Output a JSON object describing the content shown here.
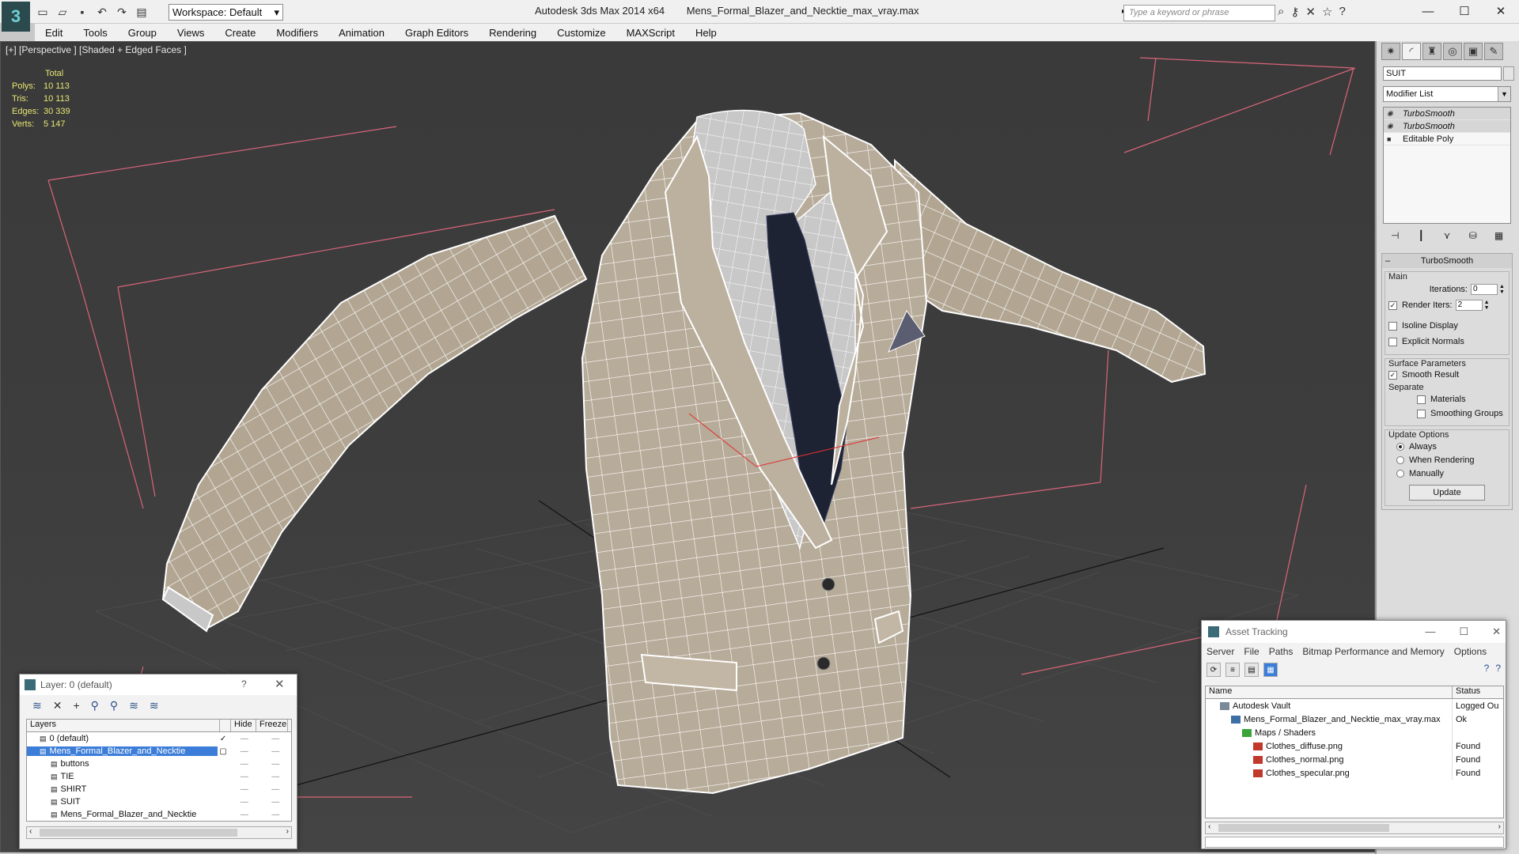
{
  "titlebar": {
    "workspace_label": "Workspace: Default",
    "app_name": "Autodesk 3ds Max  2014 x64",
    "file_name": "Mens_Formal_Blazer_and_Necktie_max_vray.max",
    "search_placeholder": "Type a keyword or phrase"
  },
  "menu": [
    "Edit",
    "Tools",
    "Group",
    "Views",
    "Create",
    "Modifiers",
    "Animation",
    "Graph Editors",
    "Rendering",
    "Customize",
    "MAXScript",
    "Help"
  ],
  "viewport": {
    "label": "[+] [Perspective ] [Shaded + Edged Faces ]",
    "stats": {
      "header": "Total",
      "rows": [
        {
          "label": "Polys:",
          "value": "10 113"
        },
        {
          "label": "Tris:",
          "value": "10 113"
        },
        {
          "label": "Edges:",
          "value": "30 339"
        },
        {
          "label": "Verts:",
          "value": "5 147"
        }
      ]
    },
    "colors": {
      "jacket": "#b9ad9b",
      "wire": "#ffffff",
      "tie": "#1e2333",
      "bbox": "#d9657a"
    }
  },
  "command_panel": {
    "object_name": "SUIT",
    "modifier_list": "Modifier List",
    "stack": [
      "TurboSmooth",
      "TurboSmooth",
      "Editable Poly"
    ],
    "rollout_title": "TurboSmooth",
    "main_label": "Main",
    "iterations_label": "Iterations:",
    "iterations_value": "0",
    "render_iters_label": "Render Iters:",
    "render_iters_value": "2",
    "isoline_label": "Isoline Display",
    "explicit_normals_label": "Explicit Normals",
    "surface_label": "Surface Parameters",
    "smooth_result_label": "Smooth Result",
    "separate_label": "Separate",
    "materials_label": "Materials",
    "smoothing_groups_label": "Smoothing Groups",
    "update_options_label": "Update Options",
    "always_label": "Always",
    "when_rendering_label": "When Rendering",
    "manually_label": "Manually",
    "update_button": "Update"
  },
  "layer_window": {
    "title": "Layer: 0 (default)",
    "help": "?",
    "col_layers": "Layers",
    "col_hide": "Hide",
    "col_freeze": "Freeze",
    "rows": [
      {
        "name": "0 (default)",
        "indent": 1
      },
      {
        "name": "Mens_Formal_Blazer_and_Necktie",
        "indent": 1,
        "selected": true
      },
      {
        "name": "buttons",
        "indent": 2
      },
      {
        "name": "TIE",
        "indent": 2
      },
      {
        "name": "SHIRT",
        "indent": 2
      },
      {
        "name": "SUIT",
        "indent": 2
      },
      {
        "name": "Mens_Formal_Blazer_and_Necktie",
        "indent": 2
      }
    ]
  },
  "asset_window": {
    "title": "Asset Tracking",
    "menu": [
      "Server",
      "File",
      "Paths",
      "Bitmap Performance and Memory",
      "Options"
    ],
    "col_name": "Name",
    "col_status": "Status",
    "rows": [
      {
        "name": "Autodesk Vault",
        "status": "Logged Ou",
        "indent": 1,
        "icon": "vault"
      },
      {
        "name": "Mens_Formal_Blazer_and_Necktie_max_vray.max",
        "status": "Ok",
        "indent": 2,
        "icon": "max"
      },
      {
        "name": "Maps / Shaders",
        "status": "",
        "indent": 3,
        "icon": "maps"
      },
      {
        "name": "Clothes_diffuse.png",
        "status": "Found",
        "indent": 4,
        "icon": "png"
      },
      {
        "name": "Clothes_normal.png",
        "status": "Found",
        "indent": 4,
        "icon": "png"
      },
      {
        "name": "Clothes_specular.png",
        "status": "Found",
        "indent": 4,
        "icon": "png"
      }
    ]
  }
}
